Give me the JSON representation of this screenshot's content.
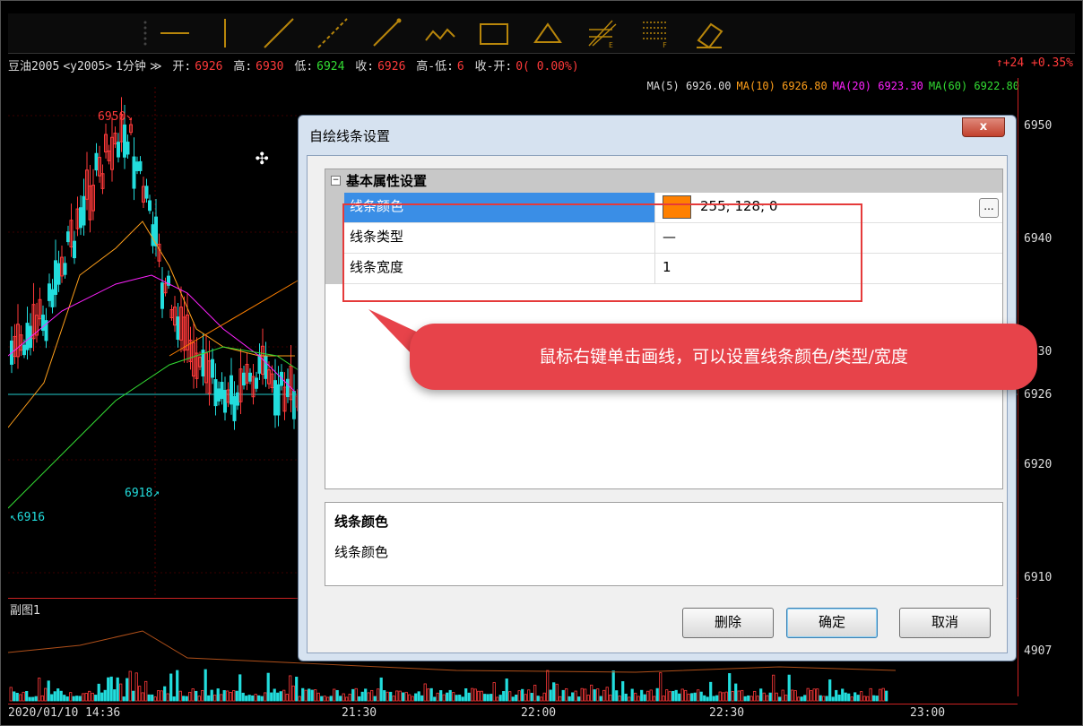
{
  "toolbar": {
    "tools": [
      "line-tool-icon",
      "vertical-line-icon",
      "ray-icon",
      "dashed-ray-icon",
      "segment-icon",
      "wave-icon",
      "rectangle-icon",
      "triangle-icon",
      "fibonacci-fan-icon",
      "fibonacci-levels-icon",
      "eraser-icon"
    ]
  },
  "infobar": {
    "symbol": "豆油2005",
    "code": "<y2005>",
    "period": "1分钟",
    "period_dropdown": "≫",
    "open_label": "开:",
    "open": "6926",
    "high_label": "高:",
    "high": "6930",
    "low_label": "低:",
    "low": "6924",
    "close_label": "收:",
    "close": "6926",
    "hl_label": "高-低:",
    "hl": "6",
    "co_label": "收-开:",
    "co": "0( 0.00%)",
    "change": "↑+24 +0.35%"
  },
  "ma": {
    "ma5": "MA(5) 6926.00",
    "ma10": "MA(10) 6926.80",
    "ma20": "MA(20) 6923.30",
    "ma60": "MA(60) 6922.80"
  },
  "price_axis": [
    "6950",
    "6940",
    "6930",
    "6926",
    "6920",
    "6910",
    "4907"
  ],
  "annotations": {
    "high_mark": "6950↘",
    "low_mark": "6918↗",
    "left_mark": "↖6916"
  },
  "sub_chart": {
    "title": "副图1"
  },
  "time_axis": [
    "2020/01/10 14:36",
    "21:30",
    "22:00",
    "22:30",
    "23:00"
  ],
  "dialog": {
    "title": "自绘线条设置",
    "close": "x",
    "category": "基本属性设置",
    "rows": [
      {
        "name": "线条颜色",
        "value": "255; 128; 0"
      },
      {
        "name": "线条类型",
        "value": "—"
      },
      {
        "name": "线条宽度",
        "value": "1"
      }
    ],
    "ellipsis": "...",
    "desc_title": "线条颜色",
    "desc_body": "线条颜色",
    "buttons": {
      "delete": "删除",
      "ok": "确定",
      "cancel": "取消"
    }
  },
  "callout": {
    "text": "鼠标右键单击画线，可以设置线条颜色/类型/宽度"
  },
  "colors": {
    "line_color": "#ff8000",
    "up": "#ff3a3a",
    "down": "#22dddd",
    "ma5": "#dddddd",
    "ma10": "#ff9f1a",
    "ma20": "#ff22ff",
    "ma60": "#33dd33"
  }
}
